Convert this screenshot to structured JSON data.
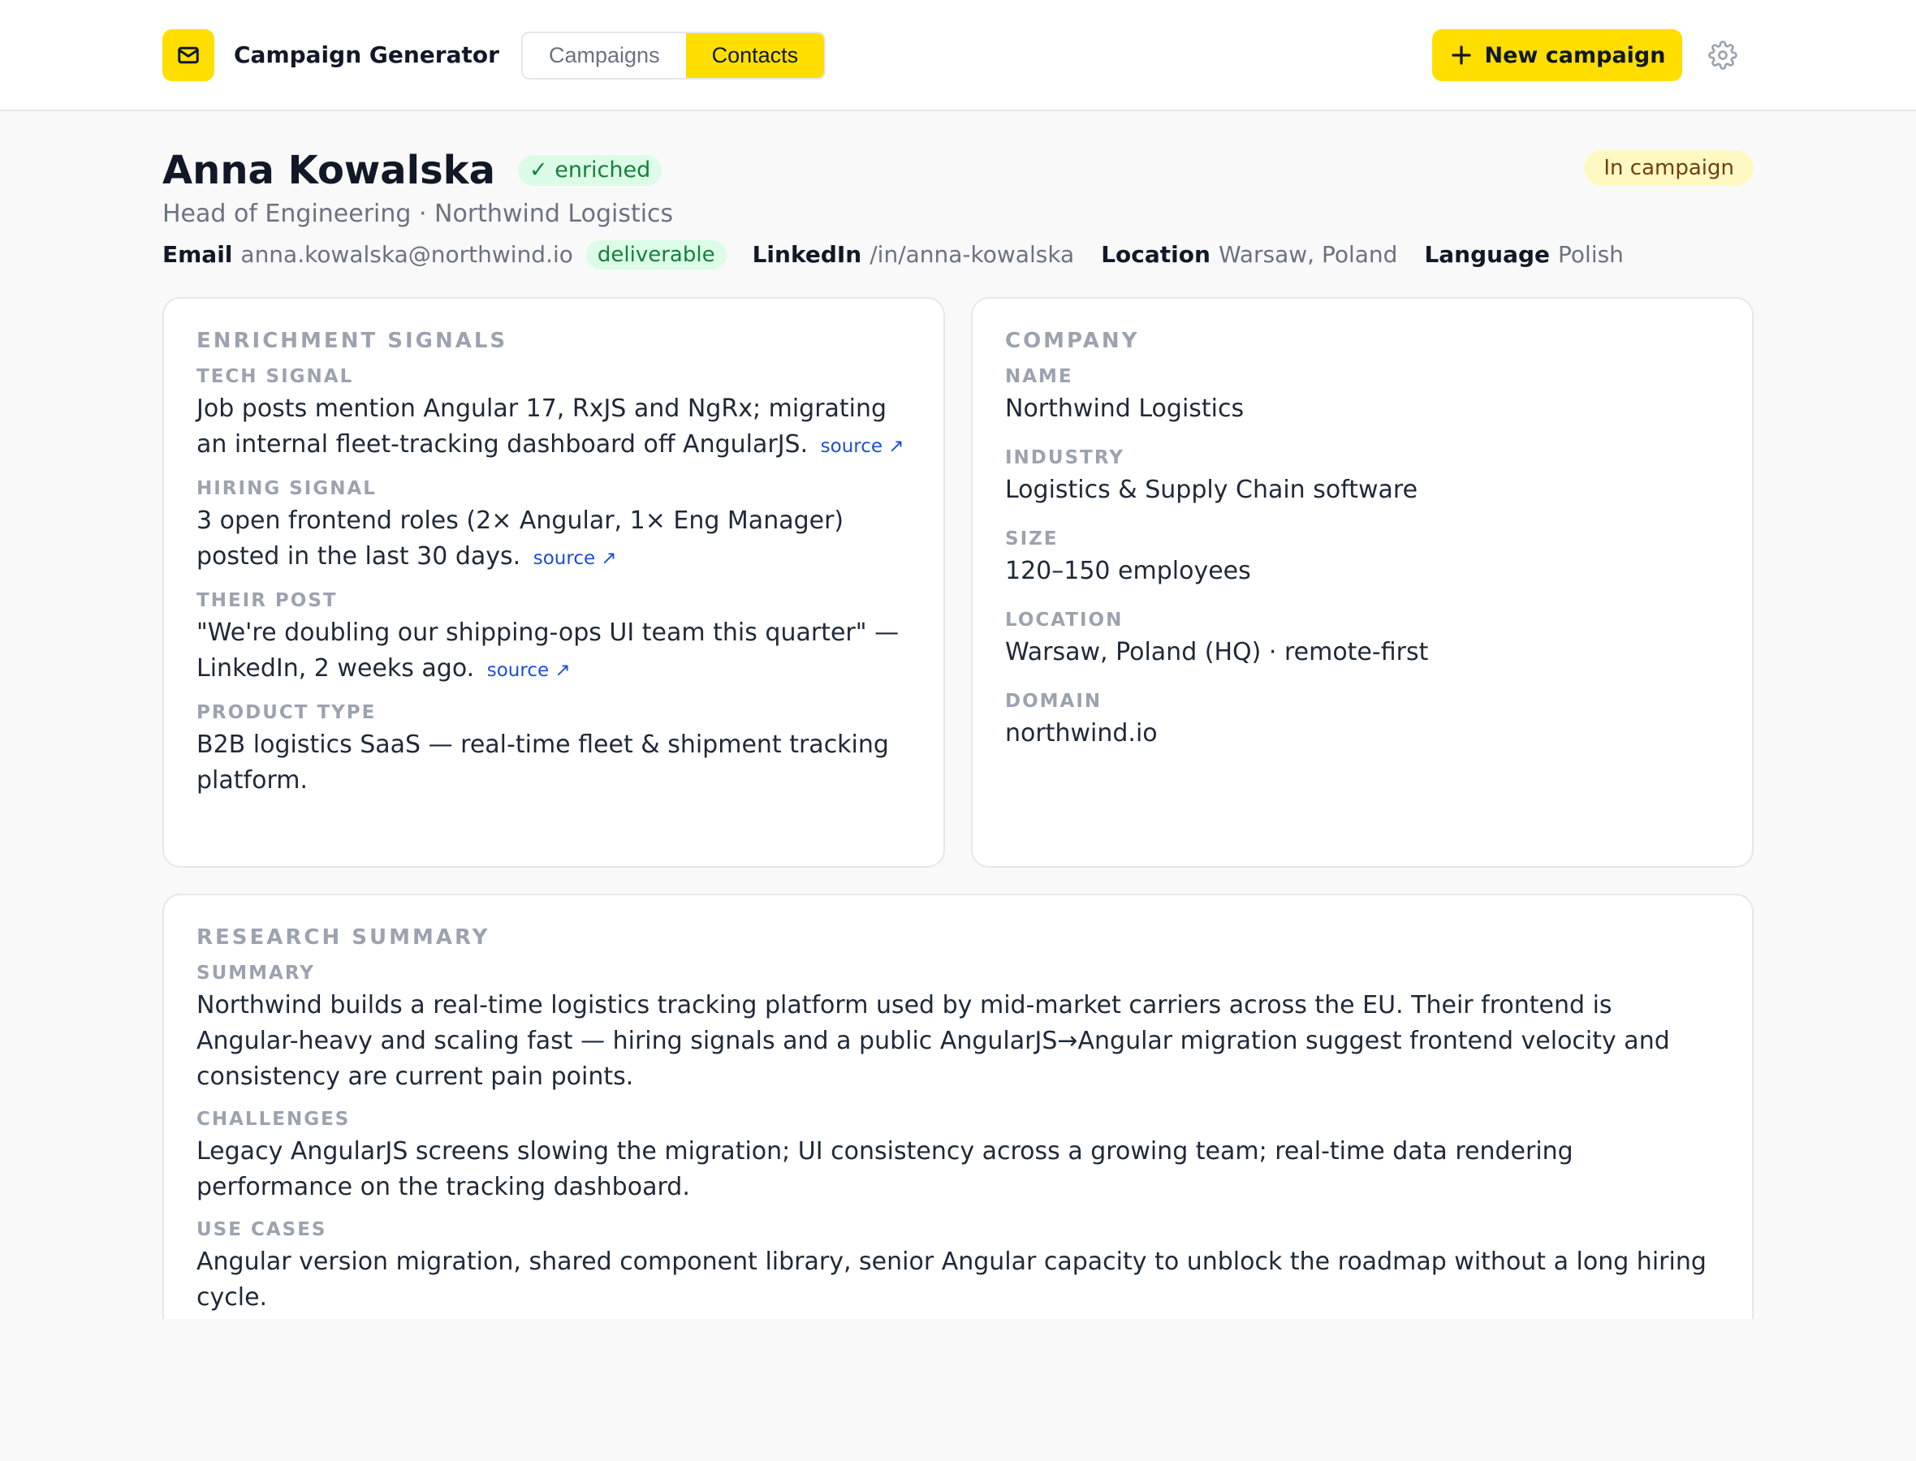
{
  "app": {
    "title": "Campaign Generator",
    "logo_icon": "mail-icon",
    "accent_color": "#ffde00"
  },
  "nav": {
    "tabs": [
      {
        "label": "Campaigns",
        "active": false
      },
      {
        "label": "Contacts",
        "active": true
      }
    ],
    "new_campaign_label": "New campaign",
    "settings_icon": "gear-icon"
  },
  "contact": {
    "name": "Anna Kowalska",
    "enriched_badge": "✓ enriched",
    "campaign_badge": "In campaign",
    "role": "Head of Engineering · Northwind Logistics",
    "email_label": "Email",
    "email": "anna.kowalska@northwind.io",
    "email_status": "deliverable",
    "linkedin_label": "LinkedIn",
    "linkedin": "/in/anna-kowalska",
    "location_label": "Location",
    "location": "Warsaw, Poland",
    "language_label": "Language",
    "language": "Polish"
  },
  "enrichment": {
    "title": "ENRICHMENT SIGNALS",
    "source_label": "source ↗",
    "fields": [
      {
        "label": "TECH SIGNAL",
        "value": "Job posts mention Angular 17, RxJS and NgRx; migrating an internal fleet-tracking dashboard off AngularJS.",
        "has_source": true
      },
      {
        "label": "HIRING SIGNAL",
        "value": "3 open frontend roles (2× Angular, 1× Eng Manager) posted in the last 30 days.",
        "has_source": true
      },
      {
        "label": "THEIR POST",
        "value": "\"We're doubling our shipping-ops UI team this quarter\" — LinkedIn, 2 weeks ago.",
        "has_source": true
      },
      {
        "label": "PRODUCT TYPE",
        "value": "B2B logistics SaaS — real-time fleet & shipment tracking platform.",
        "has_source": false
      }
    ]
  },
  "company": {
    "title": "COMPANY",
    "fields": [
      {
        "label": "NAME",
        "value": "Northwind Logistics"
      },
      {
        "label": "INDUSTRY",
        "value": "Logistics & Supply Chain software"
      },
      {
        "label": "SIZE",
        "value": "120–150 employees"
      },
      {
        "label": "LOCATION",
        "value": "Warsaw, Poland (HQ) · remote-first"
      },
      {
        "label": "DOMAIN",
        "value": "northwind.io"
      }
    ]
  },
  "research": {
    "title": "RESEARCH SUMMARY",
    "fields": [
      {
        "label": "SUMMARY",
        "value": "Northwind builds a real-time logistics tracking platform used by mid-market carriers across the EU. Their frontend is Angular-heavy and scaling fast — hiring signals and a public AngularJS→Angular migration suggest frontend velocity and consistency are current pain points."
      },
      {
        "label": "CHALLENGES",
        "value": "Legacy AngularJS screens slowing the migration; UI consistency across a growing team; real-time data rendering performance on the tracking dashboard."
      },
      {
        "label": "USE CASES",
        "value": "Angular version migration, shared component library, senior Angular capacity to unblock the roadmap without a long hiring cycle."
      }
    ]
  }
}
